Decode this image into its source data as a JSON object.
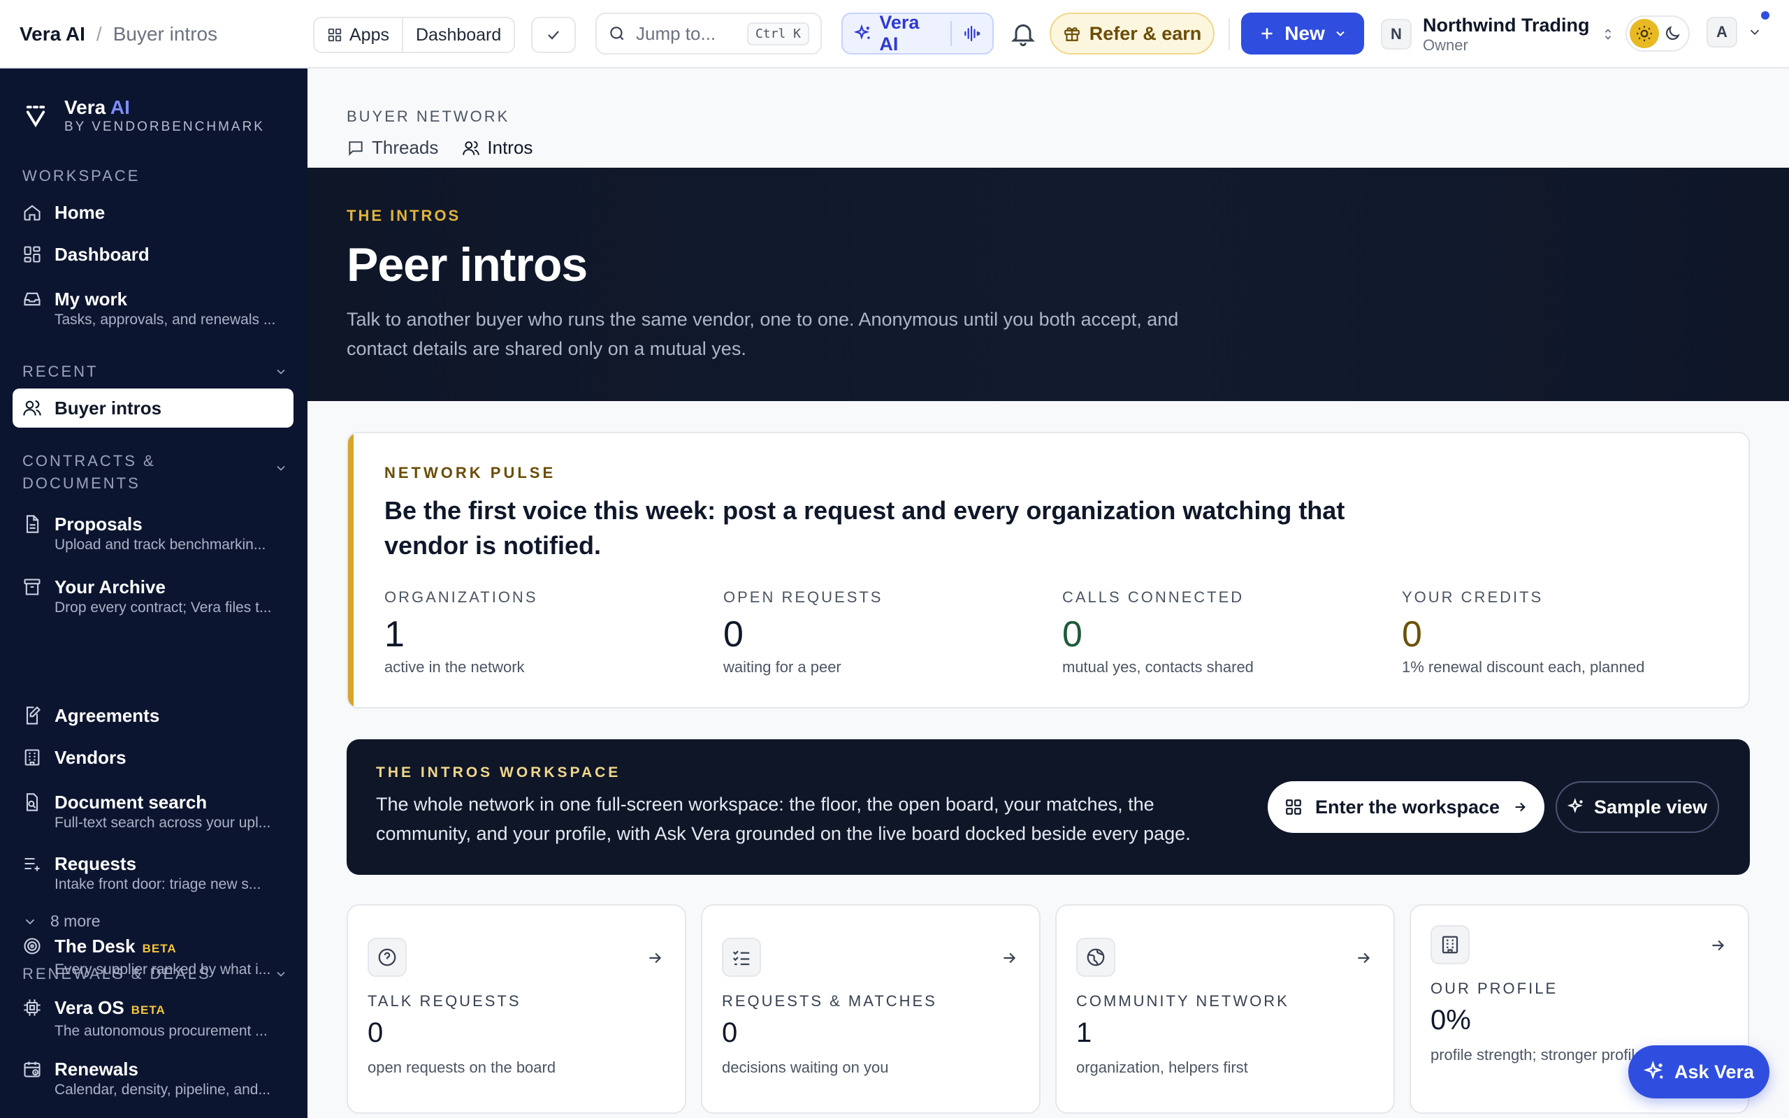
{
  "topbar": {
    "breadcrumb": {
      "root": "Vera AI",
      "separator": "/",
      "current": "Buyer intros"
    },
    "apps_label": "Apps",
    "dashboard_label": "Dashboard",
    "search": {
      "placeholder": "Jump to...",
      "shortcut": "Ctrl K"
    },
    "vera_label": "Vera AI",
    "refer_label": "Refer & earn",
    "new_label": "New",
    "org": {
      "initial": "N",
      "name": "Northwind Trading",
      "role": "Owner"
    },
    "user_initial": "A"
  },
  "sidebar": {
    "brand": {
      "name": "Vera",
      "name_accent": "AI",
      "by": "BY VENDORBENCHMARK"
    },
    "workspace_label": "WORKSPACE",
    "workspace_items": [
      {
        "label": "Home",
        "icon": "home-icon"
      },
      {
        "label": "Dashboard",
        "icon": "dashboard-icon"
      },
      {
        "label": "My work",
        "sub": "Tasks, approvals, and renewals ...",
        "icon": "inbox-icon"
      }
    ],
    "recent_label": "RECENT",
    "recent_items": [
      {
        "label": "Buyer intros",
        "icon": "users-icon"
      }
    ],
    "contracts_label": "CONTRACTS & DOCUMENTS",
    "contracts_items": [
      {
        "label": "Proposals",
        "sub": "Upload and track benchmarkin...",
        "icon": "file-icon"
      },
      {
        "label": "Your Archive",
        "sub": "Drop every contract; Vera files t...",
        "icon": "archive-icon"
      },
      {
        "label": "Agreements",
        "icon": "file-signature-icon"
      },
      {
        "label": "Vendors",
        "icon": "building-icon"
      },
      {
        "label": "Document search",
        "sub": "Full-text search across your upl...",
        "icon": "file-search-icon"
      },
      {
        "label": "Requests",
        "sub": "Intake front door: triage new s...",
        "icon": "list-plus-icon"
      }
    ],
    "more_label": "8 more",
    "renewals_label": "RENEWALS & DEALS",
    "renewals_items": [
      {
        "label": "The Desk",
        "badge": "BETA",
        "sub": "Every supplier ranked by what i...",
        "icon": "target-icon"
      },
      {
        "label": "Vera OS",
        "badge": "BETA",
        "sub": "The autonomous procurement ...",
        "icon": "cpu-icon"
      },
      {
        "label": "Renewals",
        "sub": "Calendar, density, pipeline, and...",
        "icon": "calendar-clock-icon"
      }
    ]
  },
  "main": {
    "eyebrow": "BUYER NETWORK",
    "tabs": [
      {
        "label": "Threads"
      },
      {
        "label": "Intros"
      }
    ],
    "hero": {
      "kicker": "THE INTROS",
      "title": "Peer intros",
      "description": "Talk to another buyer who runs the same vendor, one to one. Anonymous until you both accept, and contact details are shared only on a mutual yes."
    },
    "pulse": {
      "kicker": "NETWORK PULSE",
      "headline": "Be the first voice this week: post a request and every organization watching that vendor is notified.",
      "stats": [
        {
          "label": "ORGANIZATIONS",
          "value": "1",
          "desc": "active in the network",
          "color": "#0f172a"
        },
        {
          "label": "OPEN REQUESTS",
          "value": "0",
          "desc": "waiting for a peer",
          "color": "#0f172a"
        },
        {
          "label": "CALLS CONNECTED",
          "value": "0",
          "desc": "mutual yes, contacts shared",
          "color": "#1f5a3a"
        },
        {
          "label": "YOUR CREDITS",
          "value": "0",
          "desc": "1% renewal discount each, planned",
          "color": "#6b5208"
        }
      ]
    },
    "workspace": {
      "kicker": "THE INTROS WORKSPACE",
      "description": "The whole network in one full-screen workspace: the floor, the open board, your matches, the community, and your profile, with Ask Vera grounded on the live board docked beside every page.",
      "enter_label": "Enter the workspace",
      "sample_label": "Sample view"
    },
    "cards": [
      {
        "label": "TALK REQUESTS",
        "value": "0",
        "desc": "open requests on the board",
        "icon": "help-circle-icon"
      },
      {
        "label": "REQUESTS & MATCHES",
        "value": "0",
        "desc": "decisions waiting on you",
        "icon": "list-checks-icon"
      },
      {
        "label": "COMMUNITY NETWORK",
        "value": "1",
        "desc": "organization, helpers first",
        "icon": "globe-icon"
      },
      {
        "label": "OUR PROFILE",
        "value": "0%",
        "desc": "profile strength; stronger profiles faster",
        "icon": "building-icon"
      }
    ]
  },
  "ask_vera_label": "Ask Vera"
}
